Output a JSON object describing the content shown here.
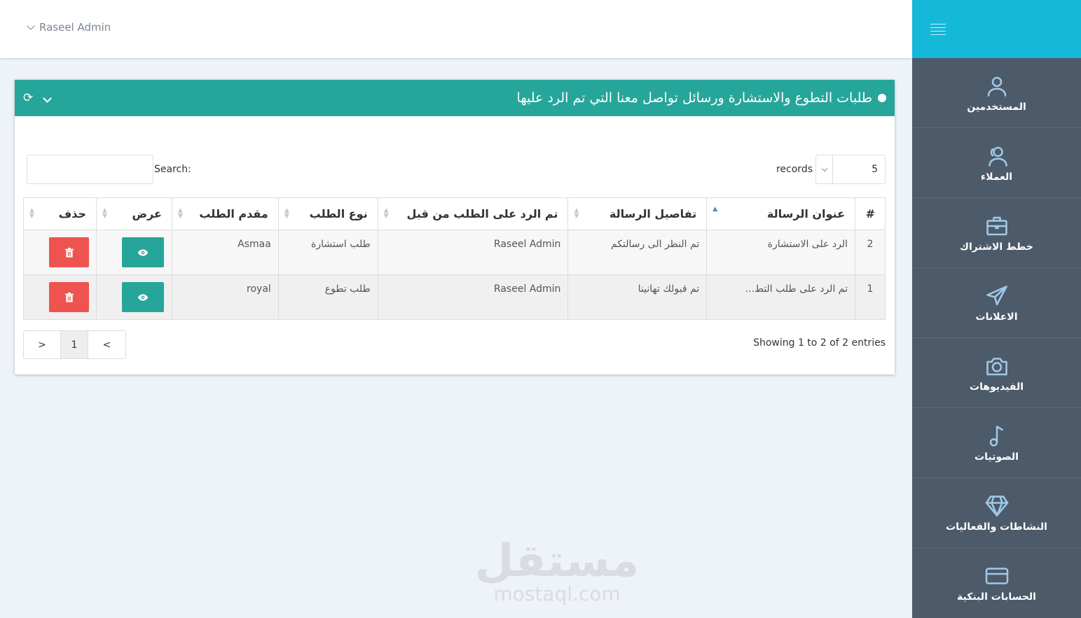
{
  "topbar": {
    "user_name": "Raseel Admin"
  },
  "sidebar": {
    "items": [
      {
        "label": "المستخدمين",
        "icon": "user-icon"
      },
      {
        "label": "العملاء",
        "icon": "users-icon"
      },
      {
        "label": "خطط الاشتراك",
        "icon": "briefcase-icon"
      },
      {
        "label": "الاعلانات",
        "icon": "send-icon"
      },
      {
        "label": "الفيديوهات",
        "icon": "camera-icon"
      },
      {
        "label": "الصوتيات",
        "icon": "music-note-icon"
      },
      {
        "label": "النشاطات والفعاليات",
        "icon": "diamond-icon"
      },
      {
        "label": "الحسابات البنكية",
        "icon": "credit-card-icon"
      }
    ]
  },
  "panel": {
    "title": "طلبات التطوع والاستشارة ورسائل تواصل معنا التي تم الرد عليها",
    "colors": {
      "header": "#26a69a",
      "view_button": "#26a69a",
      "delete_button": "#ef5350"
    }
  },
  "table_controls": {
    "search_label": "Search:",
    "search_value": "",
    "records_label": "records",
    "page_length": "5"
  },
  "table": {
    "headers": [
      "#",
      "عنوان الرسالة",
      "تفاصيل الرسالة",
      "تم الرد على الطلب من قبل",
      "نوع الطلب",
      "مقدم الطلب",
      "عرض",
      "حذف"
    ],
    "rows": [
      {
        "num": "2",
        "subject": "الرد على الاستشارة",
        "details": "تم النظر الى رسالتكم",
        "replied_by": "Raseel Admin",
        "type": "طلب استشارة",
        "requester": "Asmaa"
      },
      {
        "num": "1",
        "subject": "تم الرد على طلب التط...",
        "details": "تم قبولك تهانينا",
        "replied_by": "Raseel Admin",
        "type": "طلب تطوع",
        "requester": "royal"
      }
    ]
  },
  "pagination": {
    "info": "Showing 1 to 2 of 2 entries",
    "prev": "<",
    "current": "1",
    "next": ">"
  },
  "watermark": {
    "arabic": "مستقل",
    "latin": "mostaql.com"
  }
}
